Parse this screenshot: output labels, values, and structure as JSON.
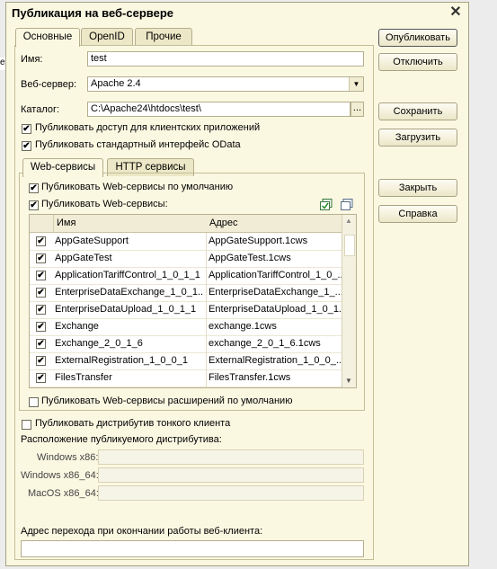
{
  "window": {
    "title": "Публикация на веб-сервере"
  },
  "tabs": [
    {
      "label": "Основные",
      "active": true
    },
    {
      "label": "OpenID",
      "active": false
    },
    {
      "label": "Прочие",
      "active": false
    }
  ],
  "form": {
    "name_label": "Имя:",
    "name_value": "test",
    "webserver_label": "Веб-сервер:",
    "webserver_value": "Apache 2.4",
    "catalog_label": "Каталог:",
    "catalog_value": "C:\\Apache24\\htdocs\\test\\",
    "catalog_button": "...",
    "publish_client_apps": {
      "label": "Публиковать доступ для клиентских приложений",
      "checked": true
    },
    "publish_odata": {
      "label": "Публиковать стандартный интерфейс OData",
      "checked": true
    }
  },
  "subtabs": [
    {
      "label": "Web-сервисы",
      "active": true
    },
    {
      "label": "HTTP сервисы",
      "active": false
    }
  ],
  "ws": {
    "publish_default": {
      "label": "Публиковать Web-сервисы по умолчанию",
      "checked": true
    },
    "publish_ws": {
      "label": "Публиковать Web-сервисы:",
      "checked": true
    },
    "columns": {
      "name": "Имя",
      "address": "Адрес"
    },
    "rows": [
      {
        "checked": true,
        "name": "AppGateSupport",
        "address": "AppGateSupport.1cws"
      },
      {
        "checked": true,
        "name": "AppGateTest",
        "address": "AppGateTest.1cws"
      },
      {
        "checked": true,
        "name": "ApplicationTariffControl_1_0_1_1",
        "address": "ApplicationTariffControl_1_0_..."
      },
      {
        "checked": true,
        "name": "EnterpriseDataExchange_1_0_1...",
        "address": "EnterpriseDataExchange_1_..."
      },
      {
        "checked": true,
        "name": "EnterpriseDataUpload_1_0_1_1",
        "address": "EnterpriseDataUpload_1_0_1..."
      },
      {
        "checked": true,
        "name": "Exchange",
        "address": "exchange.1cws"
      },
      {
        "checked": true,
        "name": "Exchange_2_0_1_6",
        "address": "exchange_2_0_1_6.1cws"
      },
      {
        "checked": true,
        "name": "ExternalRegistration_1_0_0_1",
        "address": "ExternalRegistration_1_0_0_..."
      },
      {
        "checked": true,
        "name": "FilesTransfer",
        "address": "FilesTransfer.1cws"
      }
    ],
    "publish_extensions": {
      "label": "Публиковать Web-сервисы расширений по умолчанию",
      "checked": false
    }
  },
  "distrib": {
    "publish_thin": {
      "label": "Публиковать дистрибутив тонкого клиента",
      "checked": false
    },
    "location_label": "Расположение публикуемого дистрибутива:",
    "win86_label": "Windows x86:",
    "win64_label": "Windows x86_64:",
    "mac64_label": "MacOS x86_64:",
    "win86_value": "",
    "win64_value": "",
    "mac64_value": ""
  },
  "exit_url": {
    "label": "Адрес перехода при окончании работы веб-клиента:",
    "value": ""
  },
  "buttons": {
    "publish": "Опубликовать",
    "disable": "Отключить",
    "save": "Сохранить",
    "load": "Загрузить",
    "close": "Закрыть",
    "help": "Справка"
  },
  "bg_text": "e"
}
